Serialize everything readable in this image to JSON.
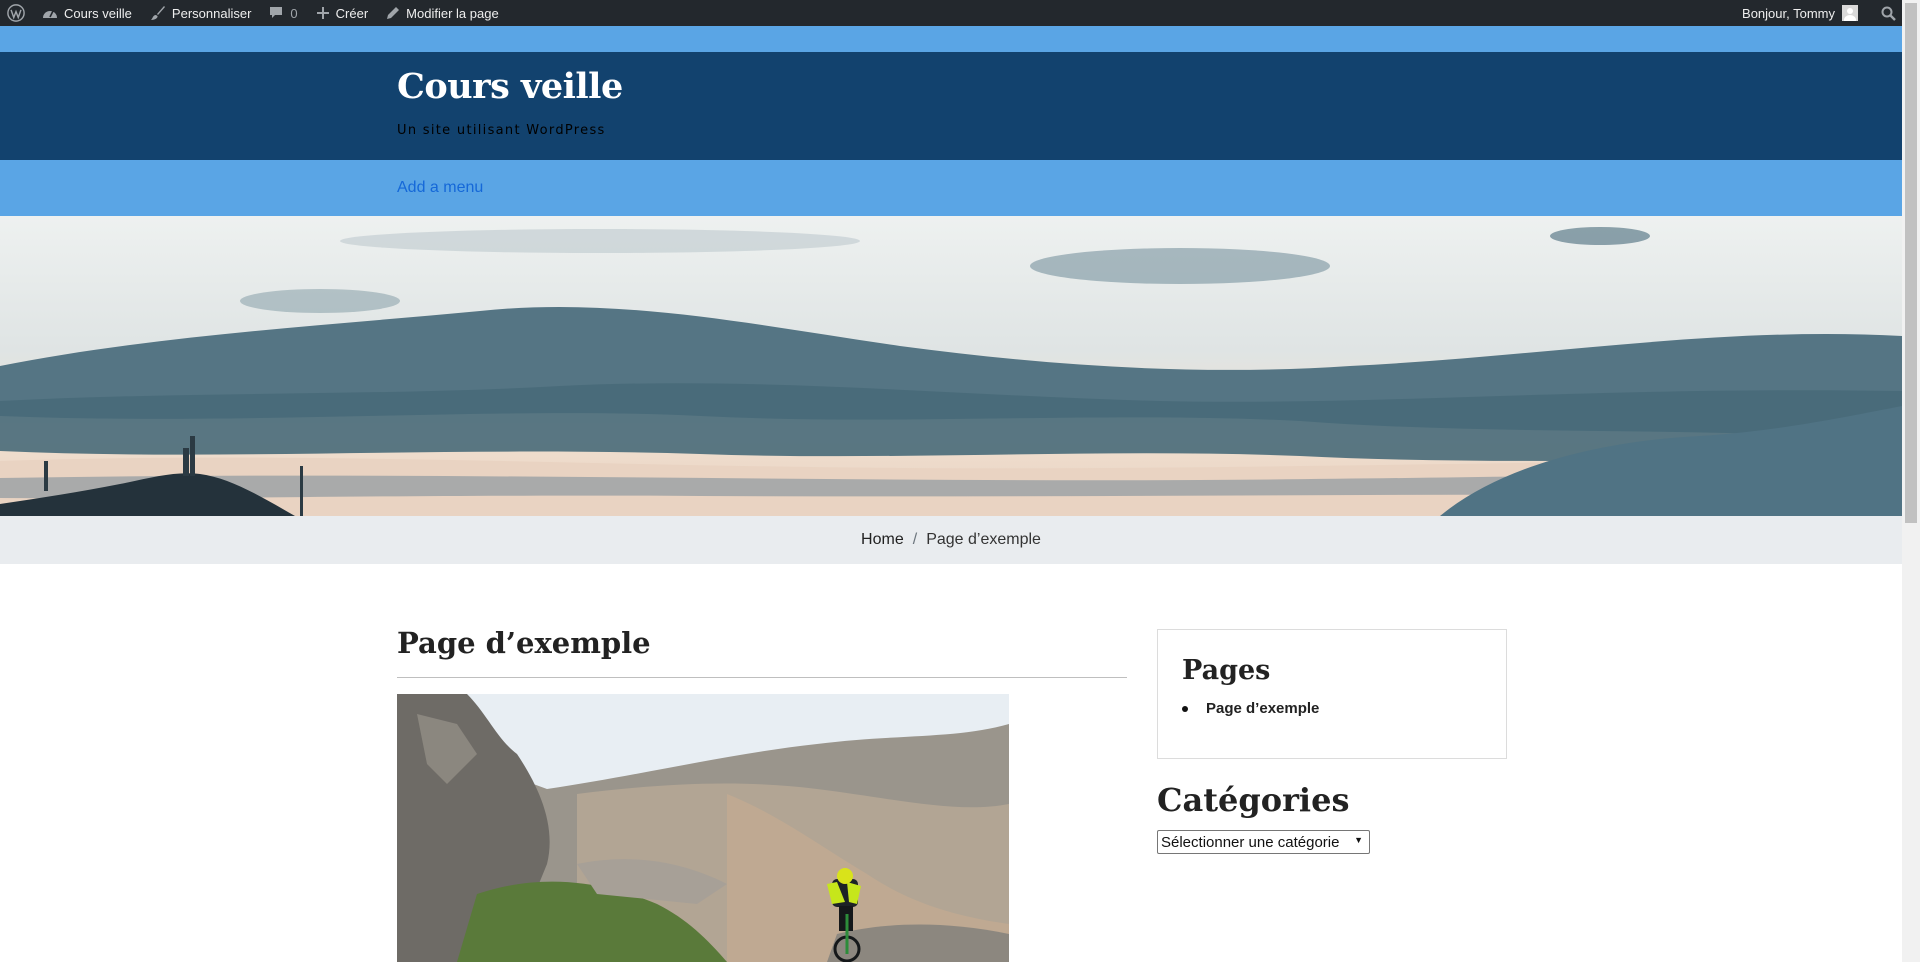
{
  "adminbar": {
    "site_name": "Cours veille",
    "customize": "Personnaliser",
    "comments_count": "0",
    "create": "Créer",
    "edit_page": "Modifier la page",
    "greeting": "Bonjour, Tommy",
    "icons": [
      "wordpress-logo-icon",
      "dashboard-icon",
      "brush-icon",
      "comment-icon",
      "plus-icon",
      "pencil-icon",
      "avatar",
      "search-icon"
    ]
  },
  "header": {
    "title": "Cours veille",
    "tagline": "Un site utilisant WordPress",
    "menu_link": "Add a menu",
    "colors": {
      "primary": "#12426e",
      "accent": "#5aa5e5",
      "link": "#1568d8"
    }
  },
  "breadcrumb": {
    "home": "Home",
    "separator": "/",
    "current": "Page d’exemple"
  },
  "main": {
    "page_title": "Page d’exemple"
  },
  "sidebar": {
    "pages_title": "Pages",
    "pages": [
      "Page d’exemple"
    ],
    "categories_title": "Catégories",
    "categories_select": "Sélectionner une catégorie"
  }
}
